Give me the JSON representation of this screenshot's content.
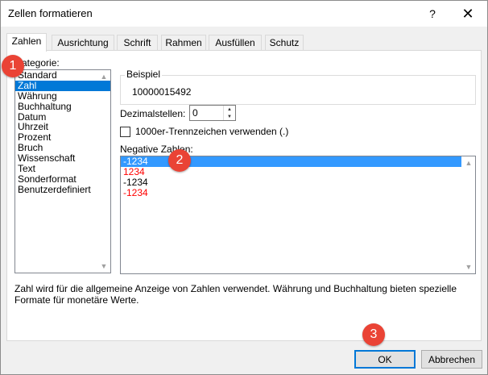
{
  "window": {
    "title": "Zellen formatieren",
    "help_icon": "?",
    "close_icon": "✕"
  },
  "tabs": [
    {
      "label": "Zahlen",
      "active": true
    },
    {
      "label": "Ausrichtung",
      "active": false
    },
    {
      "label": "Schrift",
      "active": false
    },
    {
      "label": "Rahmen",
      "active": false
    },
    {
      "label": "Ausfüllen",
      "active": false
    },
    {
      "label": "Schutz",
      "active": false
    }
  ],
  "category": {
    "label": "Kategorie:",
    "items": [
      "Standard",
      "Zahl",
      "Währung",
      "Buchhaltung",
      "Datum",
      "Uhrzeit",
      "Prozent",
      "Bruch",
      "Wissenschaft",
      "Text",
      "Sonderformat",
      "Benutzerdefiniert"
    ],
    "selected": "Zahl"
  },
  "sample": {
    "label": "Beispiel",
    "value": "10000015492"
  },
  "decimals": {
    "label": "Dezimalstellen:",
    "value": "0"
  },
  "thousands": {
    "label": "1000er-Trennzeichen verwenden (.)",
    "checked": false
  },
  "negative": {
    "label": "Negative Zahlen:",
    "items": [
      {
        "text": "-1234",
        "color": "black",
        "selected": true
      },
      {
        "text": "1234",
        "color": "red",
        "selected": false
      },
      {
        "text": "-1234",
        "color": "black",
        "selected": false
      },
      {
        "text": "-1234",
        "color": "red",
        "selected": false
      }
    ]
  },
  "description": "Zahl wird für die allgemeine Anzeige von Zahlen verwendet. Währung und Buchhaltung bieten spezielle Formate für monetäre Werte.",
  "buttons": {
    "ok": "OK",
    "cancel": "Abbrechen"
  },
  "markers": [
    "1",
    "2",
    "3"
  ],
  "colors": {
    "selection": "#0078d7",
    "negative_red": "#ff0000",
    "marker": "#ea4335"
  }
}
